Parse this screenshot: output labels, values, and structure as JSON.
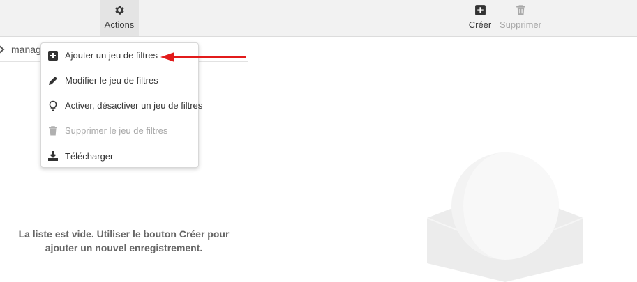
{
  "left_toolbar": {
    "actions_label": "Actions",
    "actions_icon": "gear-icon"
  },
  "right_toolbar": {
    "create_label": "Créer",
    "create_icon": "plus-square-icon",
    "delete_label": "Supprimer",
    "delete_icon": "trash-icon"
  },
  "folder": {
    "label": "manag",
    "icon": "chevron-right-icon"
  },
  "actions_menu": {
    "items": [
      {
        "label": "Ajouter un jeu de filtres",
        "icon": "plus-square-icon",
        "enabled": true
      },
      {
        "label": "Modifier le jeu de filtres",
        "icon": "pencil-icon",
        "enabled": true
      },
      {
        "label": "Activer, désactiver un jeu de filtres",
        "icon": "lightbulb-icon",
        "enabled": true
      },
      {
        "label": "Supprimer le jeu de filtres",
        "icon": "trash-icon",
        "enabled": false
      },
      {
        "label": "Télécharger",
        "icon": "download-icon",
        "enabled": true
      }
    ]
  },
  "empty_state": {
    "line1": "La liste est vide. Utiliser le bouton Créer pour",
    "line2": "ajouter un nouvel enregistrement."
  },
  "colors": {
    "annotation_arrow": "#e21b1b",
    "toolbar_bg": "#f2f2f2",
    "disabled_text": "#a8a8a8"
  }
}
